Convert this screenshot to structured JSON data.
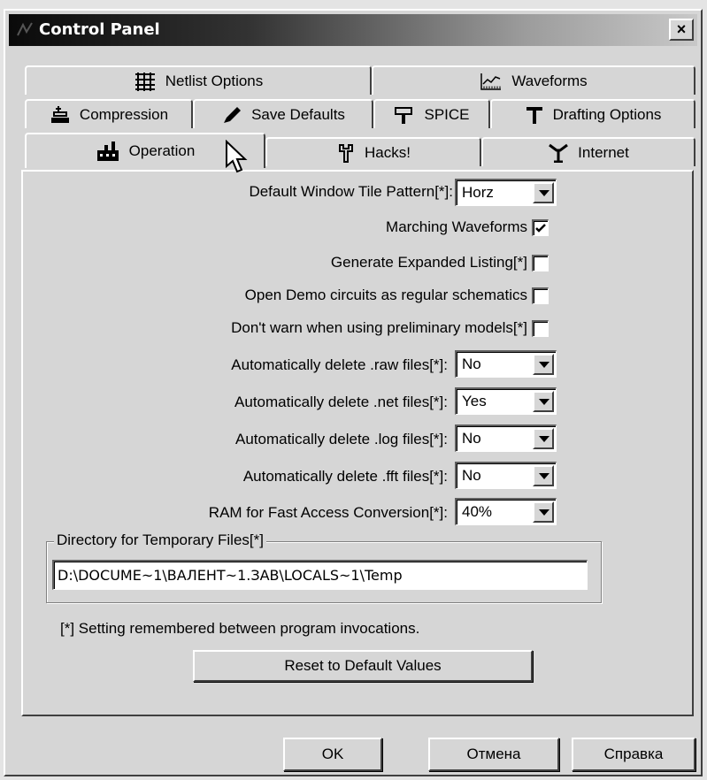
{
  "window": {
    "title": "Control Panel",
    "close_label": "×"
  },
  "tabs": {
    "row1": [
      {
        "label": "Netlist Options",
        "icon": "grid-icon"
      },
      {
        "label": "Waveforms",
        "icon": "waveform-icon"
      }
    ],
    "row2": [
      {
        "label": "Compression",
        "icon": "compression-icon"
      },
      {
        "label": "Save Defaults",
        "icon": "pen-icon"
      },
      {
        "label": "SPICE",
        "icon": "hammer-icon"
      },
      {
        "label": "Drafting Options",
        "icon": "drafting-icon"
      }
    ],
    "row3": [
      {
        "label": "Operation",
        "icon": "factory-icon",
        "active": true
      },
      {
        "label": "Hacks!",
        "icon": "wrench-icon"
      },
      {
        "label": "Internet",
        "icon": "internet-icon"
      }
    ]
  },
  "operation": {
    "tile_pattern": {
      "label": "Default Window Tile Pattern[*]:",
      "value": "Horz"
    },
    "marching_waveforms": {
      "label": "Marching Waveforms",
      "checked": true
    },
    "expanded_listing": {
      "label": "Generate Expanded Listing[*]",
      "checked": false
    },
    "open_demo": {
      "label": "Open Demo circuits as regular schematics",
      "checked": false
    },
    "dont_warn": {
      "label": "Don't warn when using preliminary models[*]",
      "checked": false
    },
    "delete_raw": {
      "label": "Automatically delete .raw files[*]:",
      "value": "No"
    },
    "delete_net": {
      "label": "Automatically delete .net files[*]:",
      "value": "Yes"
    },
    "delete_log": {
      "label": "Automatically delete .log files[*]:",
      "value": "No"
    },
    "delete_fft": {
      "label": "Automatically delete .fft files[*]:",
      "value": "No"
    },
    "ram": {
      "label": "RAM for Fast Access Conversion[*]:",
      "value": "40%"
    },
    "temp_dir": {
      "label": "Directory for Temporary Files[*]",
      "value": "D:\\DOCUME~1\\ВАЛЕНТ~1.ЗАВ\\LOCALS~1\\Temp"
    },
    "note": "[*] Setting remembered between program invocations.",
    "reset_label": "Reset to Default Values"
  },
  "footer": {
    "ok": "OK",
    "cancel": "Отмена",
    "help": "Справка"
  }
}
